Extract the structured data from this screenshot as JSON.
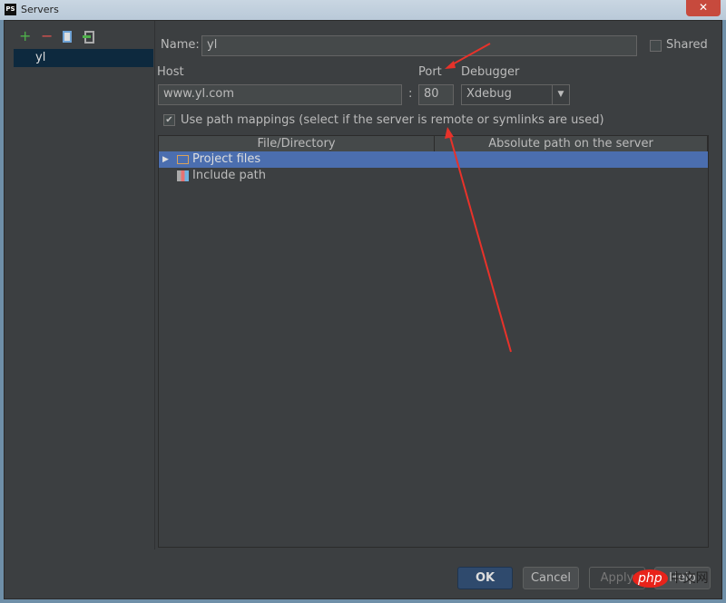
{
  "window": {
    "title": "Servers",
    "app_icon": "PS",
    "close": "✕"
  },
  "toolbar": {
    "add": "+",
    "remove": "−",
    "copy": "copy-icon",
    "import": "import-icon"
  },
  "servers": [
    {
      "name": "yl",
      "selected": true
    }
  ],
  "form": {
    "name_label": "Name:",
    "name_value": "yl",
    "shared_label": "Shared",
    "shared_checked": false,
    "host_label": "Host",
    "host_value": "www.yl.com",
    "colon": ":",
    "port_label": "Port",
    "port_value": "80",
    "debugger_label": "Debugger",
    "debugger_value": "Xdebug",
    "path_mappings_label": "Use path mappings (select if the server is remote or symlinks are used)",
    "path_mappings_checked": true
  },
  "table": {
    "columns": [
      "File/Directory",
      "Absolute path on the server"
    ],
    "rows": [
      {
        "label": "Project files",
        "selected": true
      },
      {
        "label": "Include path",
        "selected": false
      }
    ]
  },
  "buttons": {
    "ok": "OK",
    "cancel": "Cancel",
    "apply": "Apply",
    "help": "Help"
  },
  "watermark": {
    "a": "php",
    "b": "中文网"
  },
  "colors": {
    "selection": "#4b6eaf",
    "accent": "#0d293e",
    "arrow": "#e8322a"
  }
}
